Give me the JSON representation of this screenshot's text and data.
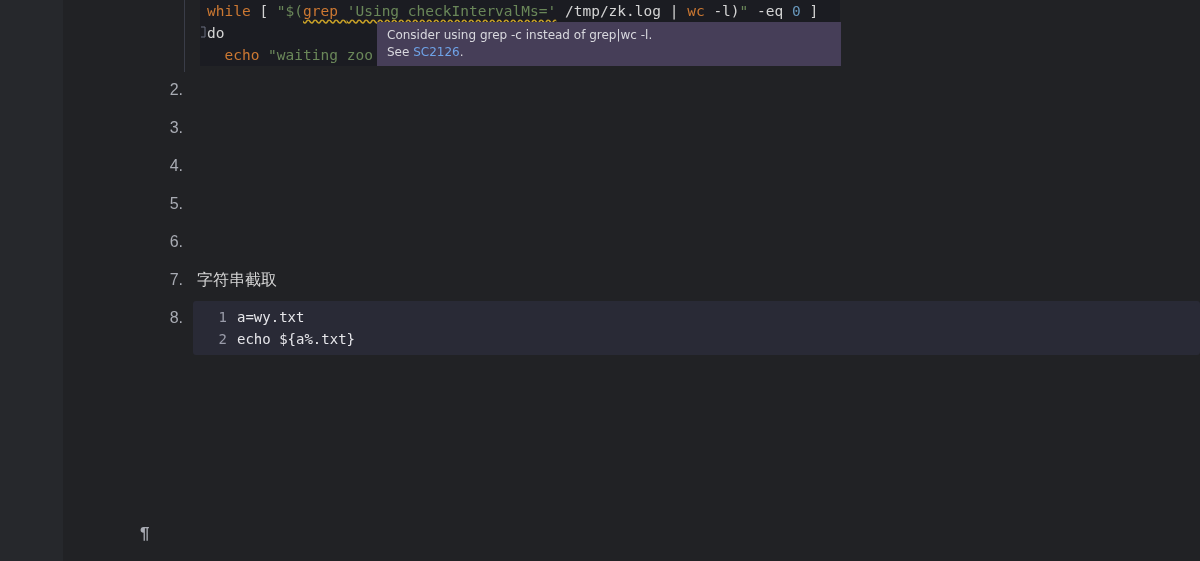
{
  "top_code": {
    "lines": [
      {
        "tokens": [
          {
            "kind": "keyword",
            "text": "while"
          },
          {
            "kind": "plain",
            "text": " [ "
          },
          {
            "kind": "string",
            "text": "\"$("
          },
          {
            "kind": "keyword",
            "text": "grep ",
            "warning": true
          },
          {
            "kind": "string",
            "text": "'Using checkIntervalMs='",
            "warning": true
          },
          {
            "kind": "plain",
            "text": " /tmp/zk.log | "
          },
          {
            "kind": "keyword",
            "text": "wc"
          },
          {
            "kind": "plain",
            "text": " -l)"
          },
          {
            "kind": "string",
            "text": "\""
          },
          {
            "kind": "plain",
            "text": " -eq "
          },
          {
            "kind": "number",
            "text": "0"
          },
          {
            "kind": "plain",
            "text": " ]"
          }
        ]
      },
      {
        "fold": true,
        "tokens": [
          {
            "kind": "plain",
            "text": "do"
          }
        ]
      },
      {
        "tokens": [
          {
            "kind": "keyword",
            "text": "  echo"
          },
          {
            "kind": "string",
            "text": " \"waiting zoo"
          }
        ]
      }
    ]
  },
  "tooltip": {
    "message": "Consider using grep -c instead of grep|wc -l.",
    "see_label": "See",
    "link": "SC2126",
    "after_link": "."
  },
  "list_items": [
    {
      "kind": "empty",
      "number": "2."
    },
    {
      "kind": "empty",
      "number": "3."
    },
    {
      "kind": "empty",
      "number": "4."
    },
    {
      "kind": "empty",
      "number": "5."
    },
    {
      "kind": "empty",
      "number": "6."
    },
    {
      "kind": "text",
      "number": "7.",
      "text": "字符串截取"
    },
    {
      "kind": "code",
      "number": "8.",
      "lines": [
        {
          "number": "1",
          "code": "a=wy.txt"
        },
        {
          "number": "2",
          "code": "echo ${a%.txt}"
        }
      ]
    }
  ],
  "pilcrow": "¶"
}
